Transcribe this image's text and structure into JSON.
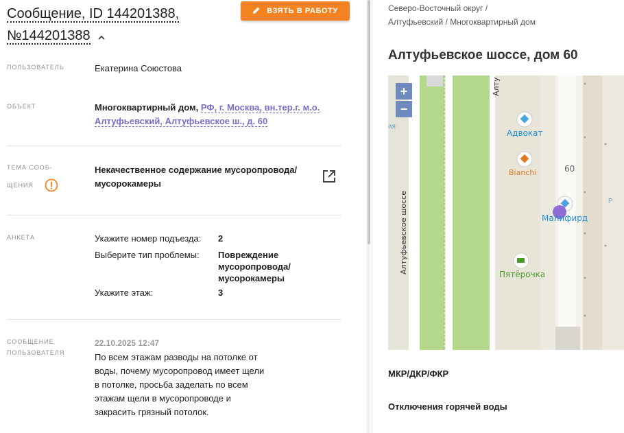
{
  "header": {
    "title_line1": "Сообщение, ID 144201388,",
    "title_line2": "№144201388",
    "take_button": "ВЗЯТЬ В РАБОТУ"
  },
  "fields": {
    "user": {
      "label": "ПОЛЬЗОВАТЕЛЬ",
      "value": "Екатерина Союстова"
    },
    "object": {
      "label": "ОБЪЕКТ",
      "type": "Многоквартирный дом,",
      "link_line1": "РФ, г. Москва, вн.тер.г. м.о.",
      "link_line2": "Алтуфьевский, Алтуфьевское ш., д. 60"
    },
    "topic": {
      "label_line1": "ТЕМА СООБ-",
      "label_line2": "ЩЕНИЯ",
      "value_line1": "Некачественное содержание мусоропровода/",
      "value_line2": "мусорокамеры"
    },
    "survey": {
      "label": "АНКЕТА",
      "rows": [
        {
          "q": "Укажите номер подъезда:",
          "a": "2"
        },
        {
          "q": "Выберите тип проблемы:",
          "a_line1": "Повреждение",
          "a_line2": "мусоропровода/",
          "a_line3": "мусорокамеры"
        },
        {
          "q": "Укажите этаж:",
          "a": "3"
        }
      ]
    },
    "message": {
      "label_line1": "СООБЩЕНИЕ",
      "label_line2": "ПОЛЬЗОВАТЕЛЯ",
      "date": "22.10.2025 12:47",
      "lines": [
        "По всем этажам разводы на потолке от",
        "воды, почему мусоропровод имеет щели",
        "в потолке, просьба заделать по всем",
        "этажам щели в мусоропроводе и",
        "закрасить грязный потолок."
      ]
    }
  },
  "right": {
    "breadcrumb_line1": "Северо-Восточный округ /",
    "breadcrumb_line2": "Алтуфьевский / Многоквартирный дом",
    "address_title": "Алтуфьевское шоссе, дом 60",
    "map": {
      "zoom_in": "+",
      "zoom_out": "−",
      "street_label": "Алтуфьевское шоссе",
      "street_label_top": "Алту",
      "house_number": "60",
      "edge_label": "ая",
      "edge_label_right": "Р",
      "pois": [
        {
          "name": "Адвокат",
          "color": "#1f8fd1"
        },
        {
          "name": "Bianchi",
          "color": "#e07b22"
        },
        {
          "name": "Малифирд",
          "color": "#1f8fd1"
        },
        {
          "name": "Пятёрочка",
          "color": "#4a9b2a"
        }
      ]
    },
    "section1": "МКР/ДКР/ФКР",
    "section2": "Отключения горячей воды"
  },
  "colors": {
    "accent": "#f58220",
    "link": "#7c6cc4",
    "map_green": "#b4d98c"
  }
}
